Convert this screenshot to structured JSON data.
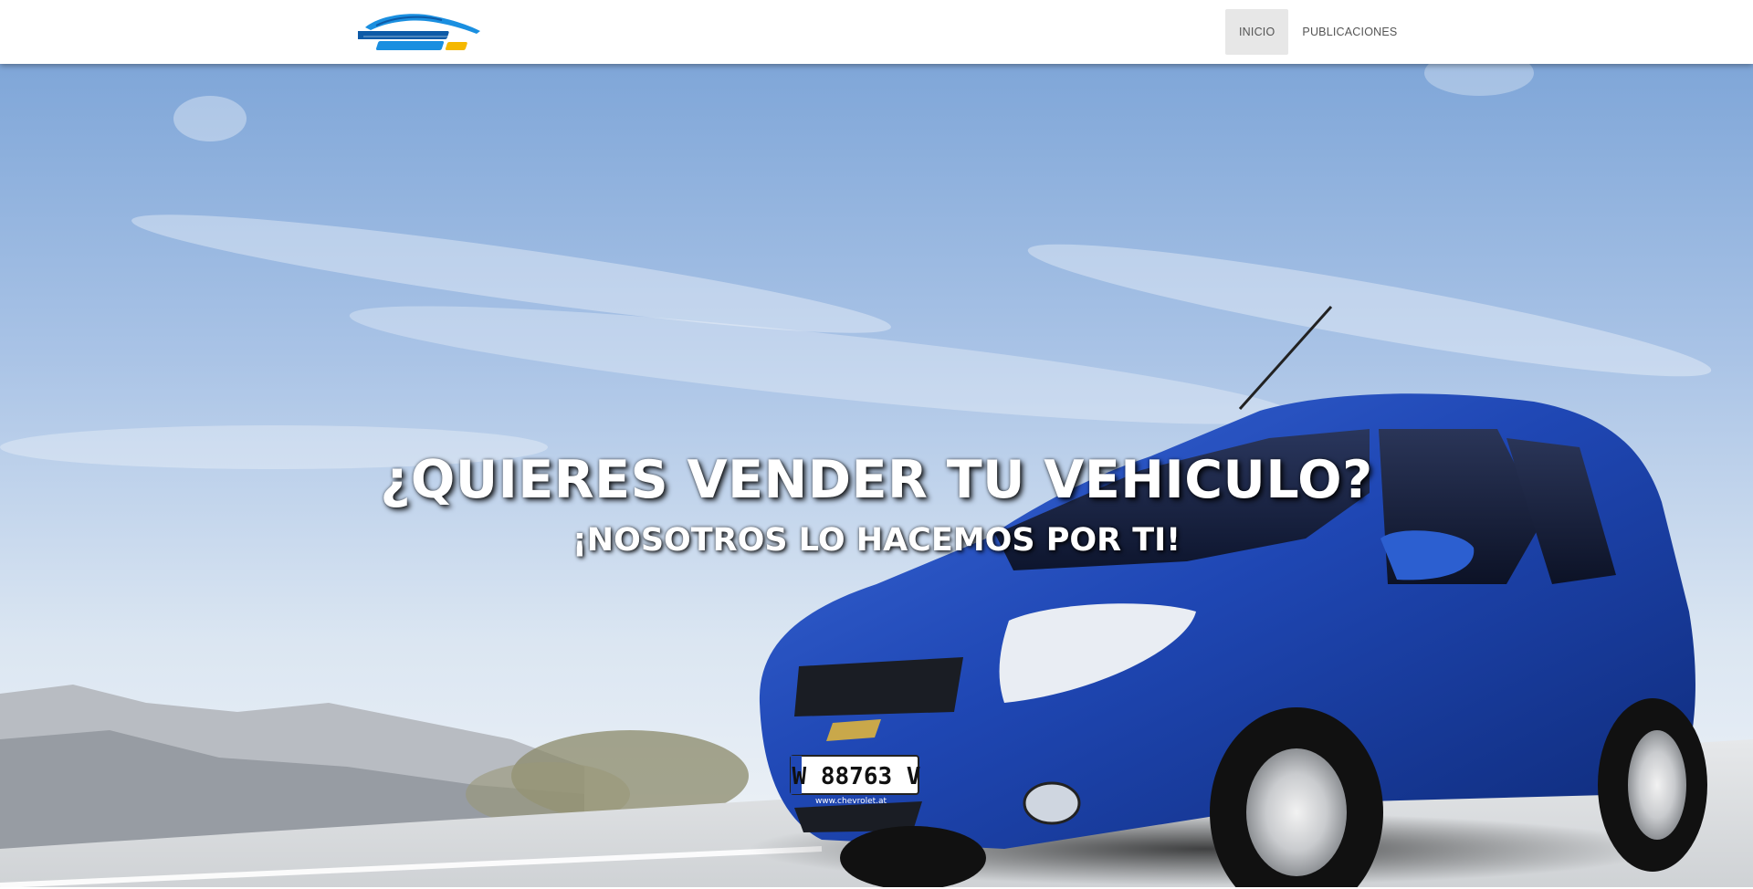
{
  "brand": {
    "logo_icon": "car-silhouette-logo-icon",
    "logo_colors": {
      "primary": "#1a8fe0",
      "dark": "#0d5aa7",
      "accent": "#f5b800"
    }
  },
  "nav": {
    "items": [
      {
        "label": "INICIO",
        "active": true
      },
      {
        "label": "PUBLICACIONES",
        "active": false
      }
    ]
  },
  "hero": {
    "title": "¿QUIERES VENDER TU VEHICULO?",
    "subtitle": "¡NOSOTROS LO HACEMOS POR TI!",
    "plate_text": "W 88763 V",
    "plate_dealer_text": "www.chevrolet.at",
    "colors": {
      "sky_top": "#8fb1dc",
      "sky_bottom": "#eef3f8",
      "car_body": "#1f47b4",
      "road": "#d9dbde"
    }
  }
}
